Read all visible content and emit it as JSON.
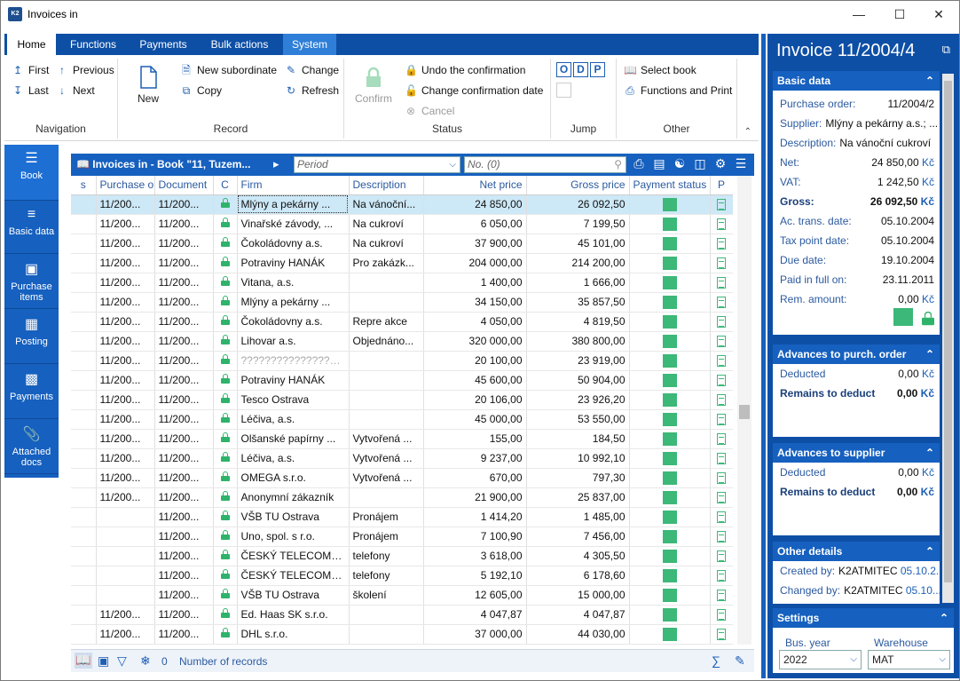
{
  "window": {
    "title": "Invoices in",
    "app_icon": "K2"
  },
  "ribbon": {
    "tabs": [
      "Home",
      "Functions",
      "Payments",
      "Bulk actions",
      "System"
    ],
    "navigation": {
      "label": "Navigation",
      "first": "First",
      "previous": "Previous",
      "last": "Last",
      "next": "Next"
    },
    "record": {
      "label": "Record",
      "new": "New",
      "new_subordinate": "New subordinate",
      "copy": "Copy",
      "change": "Change",
      "refresh": "Refresh"
    },
    "status": {
      "label": "Status",
      "confirm": "Confirm",
      "undo_confirmation": "Undo the confirmation",
      "change_confirmation_date": "Change confirmation date",
      "cancel": "Cancel"
    },
    "jump": {
      "label": "Jump",
      "o": "O",
      "d": "D",
      "p": "P"
    },
    "other": {
      "label": "Other",
      "select_book": "Select book",
      "functions_print": "Functions and Print"
    }
  },
  "leftnav": [
    {
      "label": "Book",
      "icon": "menu-icon"
    },
    {
      "label": "Basic data",
      "icon": "list-icon"
    },
    {
      "label": "Purchase items",
      "icon": "box-icon"
    },
    {
      "label": "Posting",
      "icon": "calculator-icon"
    },
    {
      "label": "Payments",
      "icon": "payment-icon"
    },
    {
      "label": "Attached docs",
      "icon": "paperclip-icon"
    }
  ],
  "gridbar": {
    "book": "Invoices in - Book \"11, Tuzem...",
    "period_placeholder": "Period",
    "number_placeholder": "No. (0)"
  },
  "table": {
    "columns": [
      "s",
      "Purchase or",
      "Document",
      "C",
      "Firm",
      "Description",
      "Net price",
      "Gross price",
      "Payment status",
      "P"
    ],
    "rows": [
      [
        "",
        "11/200...",
        "11/200...",
        "Mlýny a pekárny ...",
        "Na vánoční...",
        "24 850,00",
        "26 092,50"
      ],
      [
        "",
        "11/200...",
        "11/200...",
        "Vinařské závody, ...",
        "Na cukroví",
        "6 050,00",
        "7 199,50"
      ],
      [
        "",
        "11/200...",
        "11/200...",
        "Čokoládovny a.s.",
        "Na cukroví",
        "37 900,00",
        "45 101,00"
      ],
      [
        "",
        "11/200...",
        "11/200...",
        "Potraviny HANÁK",
        "Pro zakázk...",
        "204 000,00",
        "214 200,00"
      ],
      [
        "",
        "11/200...",
        "11/200...",
        "Vitana, a.s.",
        "",
        "1 400,00",
        "1 666,00"
      ],
      [
        "",
        "11/200...",
        "11/200...",
        "Mlýny a pekárny ...",
        "",
        "34 150,00",
        "35 857,50"
      ],
      [
        "",
        "11/200...",
        "11/200...",
        "Čokoládovny a.s.",
        "Repre akce",
        "4 050,00",
        "4 819,50"
      ],
      [
        "",
        "11/200...",
        "11/200...",
        "Lihovar a.s.",
        "Objednáno...",
        "320 000,00",
        "380 800,00"
      ],
      [
        "",
        "11/200...",
        "11/200...",
        "??????????????????",
        "",
        "20 100,00",
        "23 919,00"
      ],
      [
        "",
        "11/200...",
        "11/200...",
        "Potraviny HANÁK",
        "",
        "45 600,00",
        "50 904,00"
      ],
      [
        "",
        "11/200...",
        "11/200...",
        "Tesco Ostrava",
        "",
        "20 106,00",
        "23 926,20"
      ],
      [
        "",
        "11/200...",
        "11/200...",
        "Léčiva, a.s.",
        "",
        "45 000,00",
        "53 550,00"
      ],
      [
        "",
        "11/200...",
        "11/200...",
        "Olšanské papírny ...",
        "Vytvořená ...",
        "155,00",
        "184,50"
      ],
      [
        "",
        "11/200...",
        "11/200...",
        "Léčiva, a.s.",
        "Vytvořená ...",
        "9 237,00",
        "10 992,10"
      ],
      [
        "",
        "11/200...",
        "11/200...",
        "OMEGA s.r.o.",
        "Vytvořená ...",
        "670,00",
        "797,30"
      ],
      [
        "",
        "11/200...",
        "11/200...",
        "Anonymní zákazník",
        "",
        "21 900,00",
        "25 837,00"
      ],
      [
        "",
        "",
        "11/200...",
        "VŠB TU Ostrava",
        "Pronájem",
        "1 414,20",
        "1 485,00"
      ],
      [
        "",
        "",
        "11/200...",
        "Uno, spol. s r.o.",
        "Pronájem",
        "7 100,90",
        "7 456,00"
      ],
      [
        "",
        "",
        "11/200...",
        "ČESKÝ TELECOM, ...",
        "telefony",
        "3 618,00",
        "4 305,50"
      ],
      [
        "",
        "",
        "11/200...",
        "ČESKÝ TELECOM, ...",
        "telefony",
        "5 192,10",
        "6 178,60"
      ],
      [
        "",
        "",
        "11/200...",
        "VŠB TU Ostrava",
        "školení",
        "12 605,00",
        "15 000,00"
      ],
      [
        "",
        "11/200...",
        "11/200...",
        "Ed. Haas SK s.r.o.",
        "",
        "4 047,87",
        "4 047,87"
      ],
      [
        "",
        "11/200...",
        "11/200...",
        "DHL s.r.o.",
        "",
        "37 000,00",
        "44 030,00"
      ]
    ]
  },
  "statusbar": {
    "filter_count": "0",
    "records_label": "Number of records"
  },
  "rightpanel": {
    "title": "Invoice 11/2004/4",
    "basic": {
      "header": "Basic data",
      "purchase_order_label": "Purchase order:",
      "purchase_order": "11/2004/2",
      "supplier_label": "Supplier:",
      "supplier": "Mlýny a pekárny a.s.; ...",
      "description_label": "Description:",
      "description": "Na vánoční cukroví",
      "net_label": "Net:",
      "net": "24 850,00",
      "vat_label": "VAT:",
      "vat": "1 242,50",
      "gross_label": "Gross:",
      "gross": "26 092,50",
      "currency": "Kč",
      "ac_trans_label": "Ac. trans. date:",
      "ac_trans": "05.10.2004",
      "tax_point_label": "Tax point date:",
      "tax_point": "05.10.2004",
      "due_label": "Due date:",
      "due": "19.10.2004",
      "paid_label": "Paid in full on:",
      "paid": "23.11.2011",
      "rem_label": "Rem. amount:",
      "rem": "0,00"
    },
    "advances_order": {
      "header": "Advances to purch. order",
      "deducted_label": "Deducted",
      "deducted": "0,00",
      "remains_label": "Remains to deduct",
      "remains": "0,00"
    },
    "advances_supplier": {
      "header": "Advances to supplier",
      "deducted_label": "Deducted",
      "deducted": "0,00",
      "remains_label": "Remains to deduct",
      "remains": "0,00"
    },
    "other": {
      "header": "Other details",
      "created_label": "Created by:",
      "created_user": "K2ATMITEC",
      "created_date": "05.10.2...",
      "changed_label": "Changed by:",
      "changed_user": "K2ATMITEC",
      "changed_date": "05.10...."
    },
    "settings": {
      "header": "Settings",
      "bus_year_label": "Bus. year",
      "bus_year": "2022",
      "warehouse_label": "Warehouse",
      "warehouse": "MAT"
    }
  },
  "colors": {
    "accent": "#1660bf",
    "dark": "#0e4fa6",
    "green": "#3cb878",
    "selected_row": "#cde8f7"
  }
}
